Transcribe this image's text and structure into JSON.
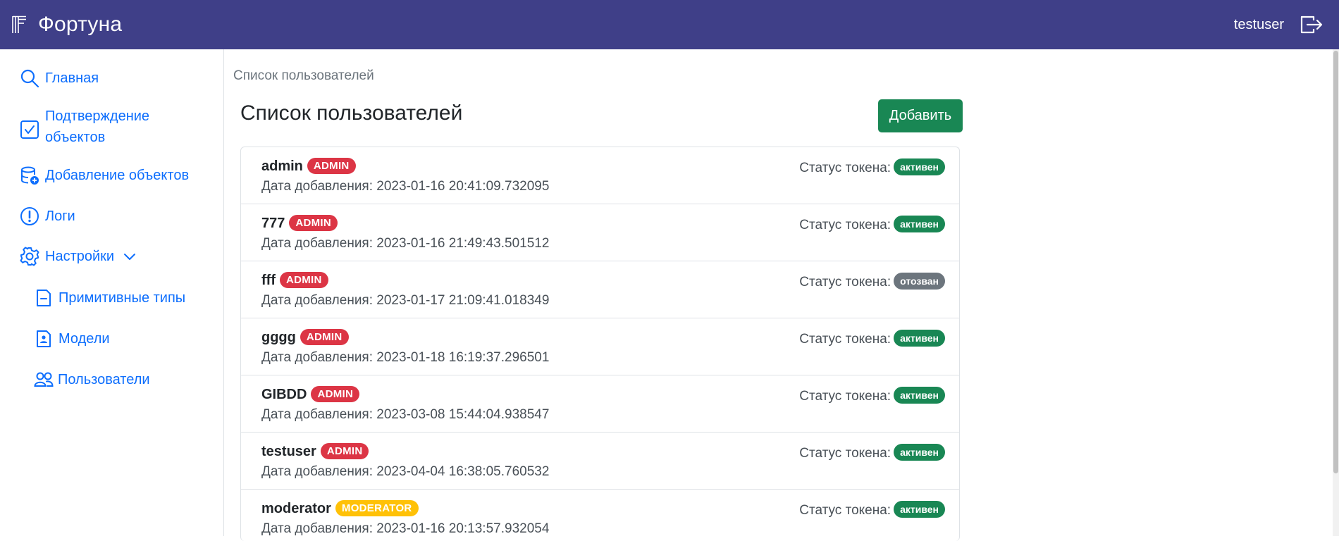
{
  "app": {
    "title": "Фортуна"
  },
  "user": {
    "name": "testuser"
  },
  "sidebar": {
    "items": [
      {
        "label": "Главная",
        "icon": "search-icon"
      },
      {
        "label": "Подтверждение объектов",
        "icon": "check-square-icon"
      },
      {
        "label": "Добавление объектов",
        "icon": "database-add-icon"
      },
      {
        "label": "Логи",
        "icon": "exclamation-circle-icon"
      },
      {
        "label": "Настройки",
        "icon": "gear-icon"
      },
      {
        "label": "Примитивные типы",
        "icon": "file-minus-icon"
      },
      {
        "label": "Модели",
        "icon": "file-person-icon"
      },
      {
        "label": "Пользователи",
        "icon": "people-icon"
      }
    ]
  },
  "breadcrumb": "Список пользователей",
  "page": {
    "title": "Список пользователей",
    "add_label": "Добавить"
  },
  "labels": {
    "status": "Статус токена:",
    "date_prefix": "Дата добавления:"
  },
  "colors": {
    "navbar": "#3f3f88",
    "admin": "#dc3545",
    "moderator": "#ffc107",
    "active": "#198754",
    "revoked": "#6c757d",
    "link": "#0d6efd"
  },
  "users": [
    {
      "name": "admin",
      "role": "ADMIN",
      "date": "2023-01-16 20:41:09.732095",
      "token": "активен"
    },
    {
      "name": "777",
      "role": "ADMIN",
      "date": "2023-01-16 21:49:43.501512",
      "token": "активен"
    },
    {
      "name": "fff",
      "role": "ADMIN",
      "date": "2023-01-17 21:09:41.018349",
      "token": "отозван"
    },
    {
      "name": "gggg",
      "role": "ADMIN",
      "date": "2023-01-18 16:19:37.296501",
      "token": "активен"
    },
    {
      "name": "GIBDD",
      "role": "ADMIN",
      "date": "2023-03-08 15:44:04.938547",
      "token": "активен"
    },
    {
      "name": "testuser",
      "role": "ADMIN",
      "date": "2023-04-04 16:38:05.760532",
      "token": "активен"
    },
    {
      "name": "moderator",
      "role": "MODERATOR",
      "date": "2023-01-16 20:13:57.932054",
      "token": "активен"
    }
  ]
}
